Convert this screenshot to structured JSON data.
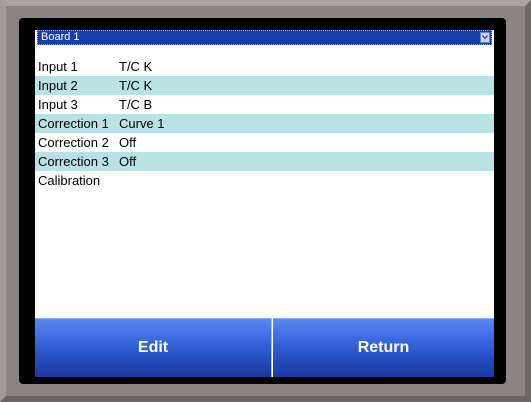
{
  "board_select": {
    "selected": "Board 1",
    "icon": "chevron-down-icon"
  },
  "list": {
    "items": [
      {
        "name": "Input 1",
        "value": "T/C K"
      },
      {
        "name": "Input 2",
        "value": "T/C K"
      },
      {
        "name": "Input 3",
        "value": "T/C B"
      },
      {
        "name": "Correction 1",
        "value": "Curve 1"
      },
      {
        "name": "Correction 2",
        "value": "Off"
      },
      {
        "name": "Correction 3",
        "value": "Off"
      },
      {
        "name": "Calibration",
        "value": ""
      }
    ]
  },
  "buttons": {
    "edit_label": "Edit",
    "return_label": "Return"
  },
  "colors": {
    "select_bg": "#1a3faa",
    "row_alt_bg": "#b9e3e3",
    "button_top": "#5a88f0",
    "button_bottom": "#1a3aa0",
    "bezel": "#8a8482"
  }
}
